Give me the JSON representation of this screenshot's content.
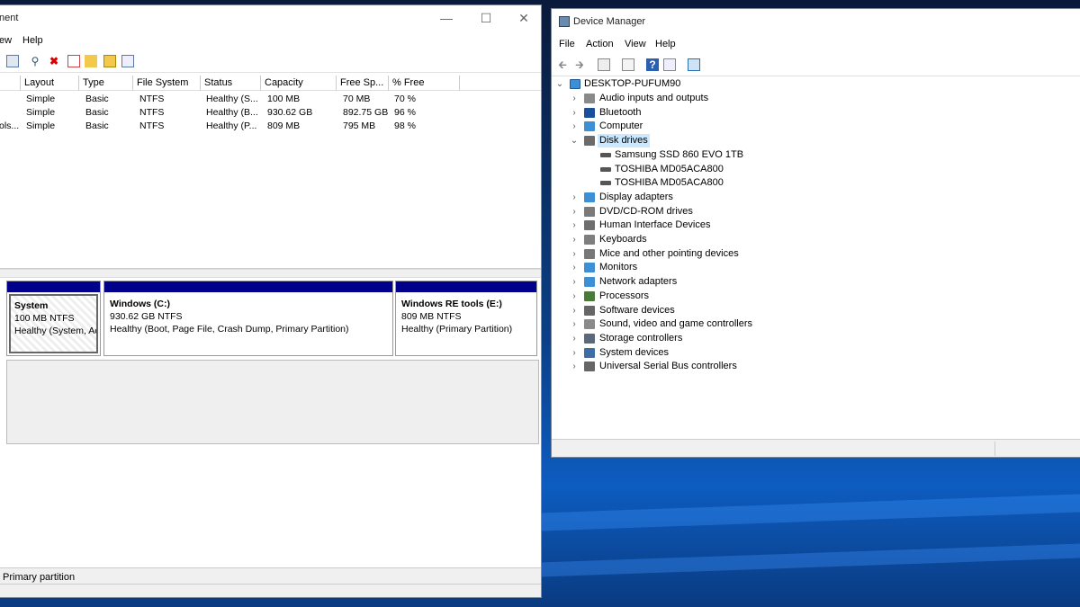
{
  "disk_mgmt": {
    "title_fragment": "nent",
    "menu": [
      "ew",
      "Help"
    ],
    "columns": [
      "Layout",
      "Type",
      "File System",
      "Status",
      "Capacity",
      "Free Sp...",
      "% Free"
    ],
    "rows": [
      {
        "volume": "",
        "layout": "Simple",
        "type": "Basic",
        "fs": "NTFS",
        "status": "Healthy (S...",
        "capacity": "100 MB",
        "free": "70 MB",
        "pct": "70 %"
      },
      {
        "volume": "",
        "layout": "Simple",
        "type": "Basic",
        "fs": "NTFS",
        "status": "Healthy (B...",
        "capacity": "930.62 GB",
        "free": "892.75 GB",
        "pct": "96 %"
      },
      {
        "volume": "ols...",
        "layout": "Simple",
        "type": "Basic",
        "fs": "NTFS",
        "status": "Healthy (P...",
        "capacity": "809 MB",
        "free": "795 MB",
        "pct": "98 %"
      }
    ],
    "partitions": [
      {
        "name": "System",
        "size": "100 MB NTFS",
        "status": "Healthy (System, Act"
      },
      {
        "name": "Windows  (C:)",
        "size": "930.62 GB NTFS",
        "status": "Healthy (Boot, Page File, Crash Dump, Primary Partition)"
      },
      {
        "name": "Windows RE tools  (E:)",
        "size": "809 MB NTFS",
        "status": "Healthy (Primary Partition)"
      }
    ],
    "legend": "Primary partition",
    "colors": {
      "partition_bar": "#00008b"
    }
  },
  "device_manager": {
    "title": "Device Manager",
    "menu": [
      "File",
      "Action",
      "View",
      "Help"
    ],
    "root": "DESKTOP-PUFUM90",
    "categories": [
      {
        "label": "Audio inputs and outputs",
        "icon": "speaker-icon",
        "color": "#8a8a8a"
      },
      {
        "label": "Bluetooth",
        "icon": "bluetooth-icon",
        "color": "#1b4f9c"
      },
      {
        "label": "Computer",
        "icon": "computer-icon",
        "color": "#3d8fd6"
      },
      {
        "label": "Disk drives",
        "icon": "disk-icon",
        "color": "#6b6b6b"
      },
      {
        "label": "Display adapters",
        "icon": "display-adapter-icon",
        "color": "#3d8fd6"
      },
      {
        "label": "DVD/CD-ROM drives",
        "icon": "dvd-icon",
        "color": "#7a7a7a"
      },
      {
        "label": "Human Interface Devices",
        "icon": "hid-icon",
        "color": "#6e6e6e"
      },
      {
        "label": "Keyboards",
        "icon": "keyboard-icon",
        "color": "#7e7e7e"
      },
      {
        "label": "Mice and other pointing devices",
        "icon": "mouse-icon",
        "color": "#777777"
      },
      {
        "label": "Monitors",
        "icon": "monitor-icon",
        "color": "#3d8fd6"
      },
      {
        "label": "Network adapters",
        "icon": "network-icon",
        "color": "#3d8fd6"
      },
      {
        "label": "Processors",
        "icon": "processor-icon",
        "color": "#4a7a3a"
      },
      {
        "label": "Software devices",
        "icon": "software-device-icon",
        "color": "#666666"
      },
      {
        "label": "Sound, video and game controllers",
        "icon": "sound-icon",
        "color": "#8a8a8a"
      },
      {
        "label": "Storage controllers",
        "icon": "storage-icon",
        "color": "#5a6a7a"
      },
      {
        "label": "System devices",
        "icon": "system-device-icon",
        "color": "#3d6fa6"
      },
      {
        "label": "Universal Serial Bus controllers",
        "icon": "usb-icon",
        "color": "#666666"
      }
    ],
    "disk_children": [
      "Samsung SSD 860 EVO 1TB",
      "TOSHIBA MD05ACA800",
      "TOSHIBA MD05ACA800"
    ],
    "colors": {
      "selection": "#cce8ff"
    }
  }
}
